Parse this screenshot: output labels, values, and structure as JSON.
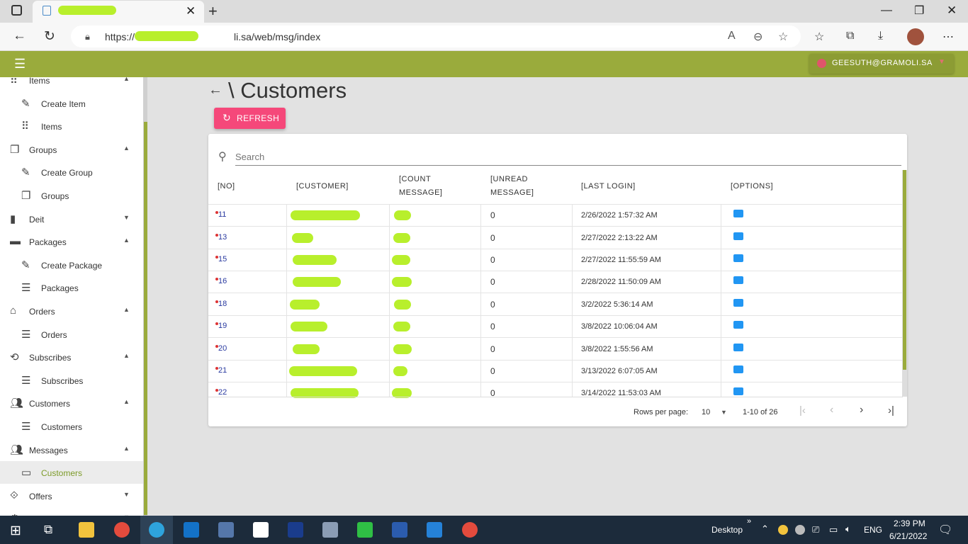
{
  "browser": {
    "url": "https://",
    "url_tail": "li.sa/web/msg/index"
  },
  "header": {
    "user": "GEESUTH@GRAMOLI.SA"
  },
  "sidebar": {
    "items": [
      {
        "label": "Items",
        "icon": "grid-icon",
        "indent": false,
        "caret": "▲"
      },
      {
        "label": "Create Item",
        "icon": "pencil-icon",
        "indent": true
      },
      {
        "label": "Items",
        "icon": "grid-icon",
        "indent": true
      },
      {
        "label": "Groups",
        "icon": "copy-icon",
        "indent": false,
        "caret": "▲"
      },
      {
        "label": "Create Group",
        "icon": "pencil-icon",
        "indent": true
      },
      {
        "label": "Groups",
        "icon": "copy-icon",
        "indent": true
      },
      {
        "label": "Deit",
        "icon": "bar-chart-icon",
        "indent": false,
        "caret": "▼"
      },
      {
        "label": "Packages",
        "icon": "package-icon",
        "indent": false,
        "caret": "▲"
      },
      {
        "label": "Create Package",
        "icon": "pencil-icon",
        "indent": true
      },
      {
        "label": "Packages",
        "icon": "list-icon",
        "indent": true
      },
      {
        "label": "Orders",
        "icon": "orders-icon",
        "indent": false,
        "caret": "▲"
      },
      {
        "label": "Orders",
        "icon": "list-icon",
        "indent": true
      },
      {
        "label": "Subscribes",
        "icon": "subscribe-icon",
        "indent": false,
        "caret": "▲"
      },
      {
        "label": "Subscribes",
        "icon": "list-icon",
        "indent": true
      },
      {
        "label": "Customers",
        "icon": "people-icon",
        "indent": false,
        "caret": "▲"
      },
      {
        "label": "Customers",
        "icon": "list-icon",
        "indent": true
      },
      {
        "label": "Messages",
        "icon": "people-icon",
        "indent": false,
        "caret": "▲"
      },
      {
        "label": "Customers",
        "icon": "message-icon",
        "indent": true,
        "active": true
      },
      {
        "label": "Offers",
        "icon": "offers-icon",
        "indent": false,
        "caret": "▼"
      },
      {
        "label": "Settings",
        "icon": "gear-icon",
        "indent": false,
        "caret": "▼"
      }
    ]
  },
  "page": {
    "title": "\\ Customers",
    "refresh_label": "REFRESH",
    "search_placeholder": "Search"
  },
  "table": {
    "headers": {
      "no": "[NO]",
      "customer": "[CUSTOMER]",
      "count_a": "[COUNT",
      "count_b": "MESSAGE]",
      "unread_a": "[UNREAD",
      "unread_b": "MESSAGE]",
      "last_login": "[LAST LOGIN]",
      "options": "[OPTIONS]"
    },
    "rows": [
      {
        "no": "11",
        "unread": "0",
        "last_login": "2/26/2022 1:57:32 AM"
      },
      {
        "no": "13",
        "unread": "0",
        "last_login": "2/27/2022 2:13:22 AM"
      },
      {
        "no": "15",
        "unread": "0",
        "last_login": "2/27/2022 11:55:59 AM"
      },
      {
        "no": "16",
        "unread": "0",
        "last_login": "2/28/2022 11:50:09 AM"
      },
      {
        "no": "18",
        "unread": "0",
        "last_login": "3/2/2022 5:36:14 AM"
      },
      {
        "no": "19",
        "unread": "0",
        "last_login": "3/8/2022 10:06:04 AM"
      },
      {
        "no": "20",
        "unread": "0",
        "last_login": "3/8/2022 1:55:56 AM"
      },
      {
        "no": "21",
        "unread": "0",
        "last_login": "3/13/2022 6:07:05 AM"
      },
      {
        "no": "22",
        "unread": "0",
        "last_login": "3/14/2022 11:53:03 AM"
      }
    ],
    "footer": {
      "rows_per_page_label": "Rows per page:",
      "rows_per_page": "10",
      "range": "1-10 of 26"
    }
  },
  "taskbar": {
    "desktop": "Desktop",
    "lang": "ENG",
    "time": "2:39 PM",
    "date": "6/21/2022"
  },
  "colors": {
    "accent": "#9aab3c",
    "refresh": "#f5487a",
    "redacted": "#b8ef2c"
  }
}
